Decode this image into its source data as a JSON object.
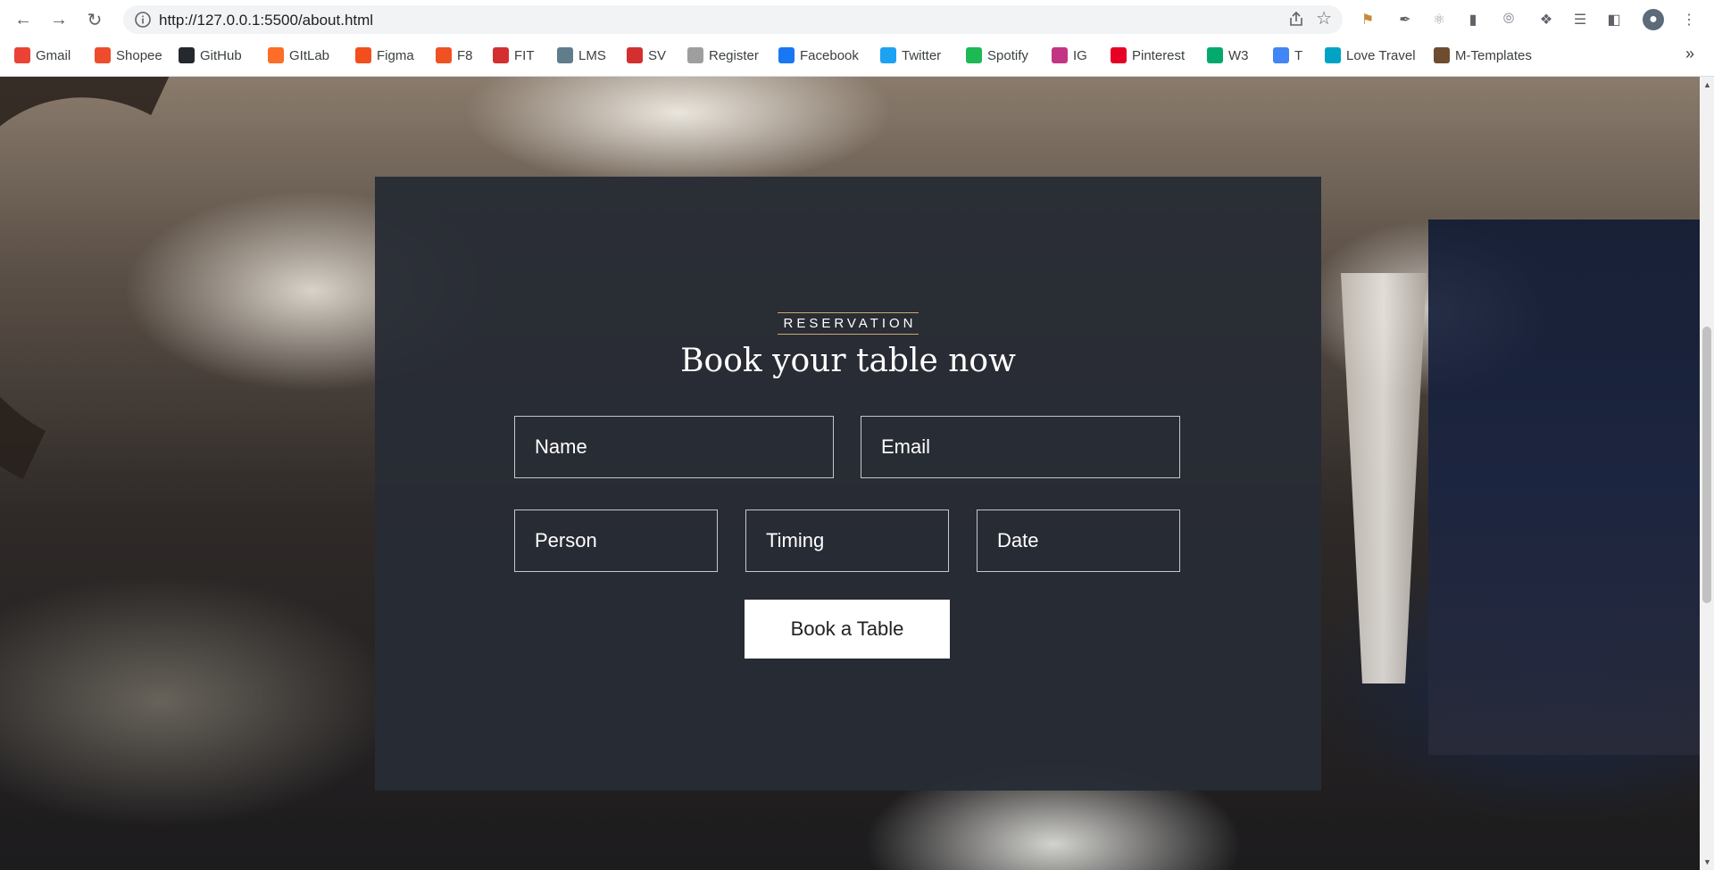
{
  "browser": {
    "url": "http://127.0.0.1:5500/about.html",
    "bookmarks": [
      {
        "label": "Gmail",
        "icon": "gmail-icon",
        "color": "#ea4335"
      },
      {
        "label": "Shopee",
        "icon": "shopee-icon",
        "color": "#ee4d2d"
      },
      {
        "label": "GitHub",
        "icon": "github-icon",
        "color": "#24292e"
      },
      {
        "label": "GItLab",
        "icon": "gitlab-icon",
        "color": "#fc6d26"
      },
      {
        "label": "Figma",
        "icon": "figma-icon",
        "color": "#f24e1e"
      },
      {
        "label": "F8",
        "icon": "f8-icon",
        "color": "#f05123"
      },
      {
        "label": "FIT",
        "icon": "fit-icon",
        "color": "#d32f2f"
      },
      {
        "label": "LMS",
        "icon": "lms-icon",
        "color": "#607d8b"
      },
      {
        "label": "SV",
        "icon": "sv-icon",
        "color": "#d32f2f"
      },
      {
        "label": "Register",
        "icon": "register-icon",
        "color": "#9e9e9e"
      },
      {
        "label": "Facebook",
        "icon": "facebook-icon",
        "color": "#1877f2"
      },
      {
        "label": "Twitter",
        "icon": "twitter-icon",
        "color": "#1da1f2"
      },
      {
        "label": "Spotify",
        "icon": "spotify-icon",
        "color": "#1db954"
      },
      {
        "label": "IG",
        "icon": "instagram-icon",
        "color": "#c13584"
      },
      {
        "label": "Pinterest",
        "icon": "pinterest-icon",
        "color": "#e60023"
      },
      {
        "label": "W3",
        "icon": "w3-icon",
        "color": "#04aa6d"
      },
      {
        "label": "T",
        "icon": "translate-icon",
        "color": "#4285f4"
      },
      {
        "label": "Love Travel",
        "icon": "love-travel-icon",
        "color": "#00a3c4"
      },
      {
        "label": "M-Templates",
        "icon": "m-templates-icon",
        "color": "#6d4c2f"
      }
    ]
  },
  "reservation": {
    "kicker": "RESERVATION",
    "heading": "Book your table now",
    "fields": {
      "name": "Name",
      "email": "Email",
      "person": "Person",
      "timing": "Timing",
      "date": "Date"
    },
    "button": "Book a Table"
  }
}
